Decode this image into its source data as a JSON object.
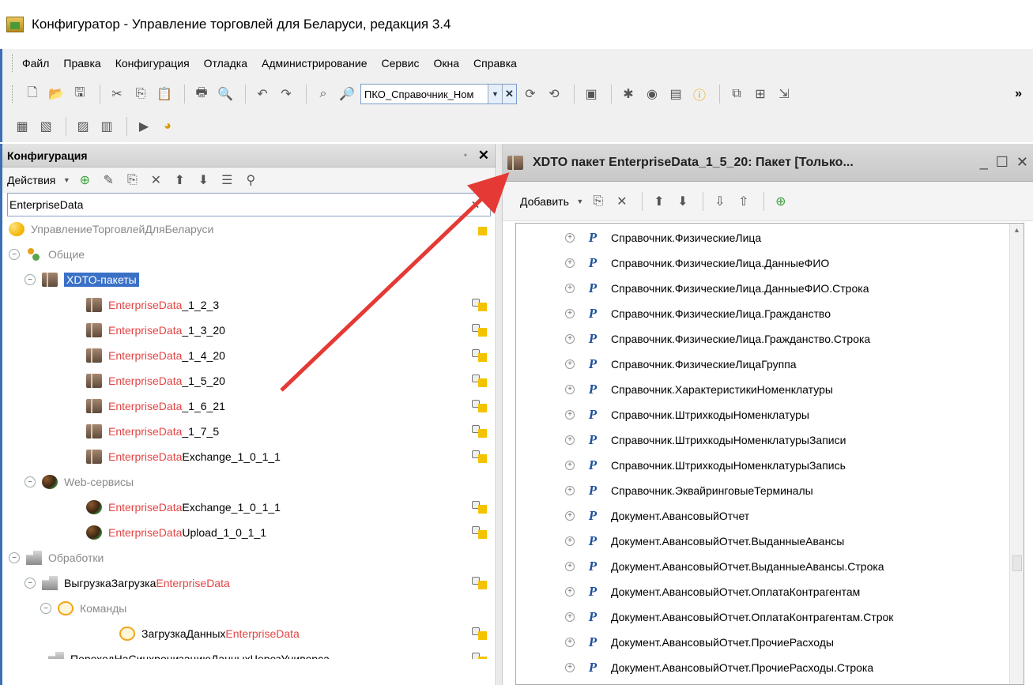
{
  "window": {
    "title": "Конфигуратор - Управление торговлей для Беларуси, редакция 3.4"
  },
  "menu": [
    "Файл",
    "Правка",
    "Конфигурация",
    "Отладка",
    "Администрирование",
    "Сервис",
    "Окна",
    "Справка"
  ],
  "toolbar": {
    "search_value": "ПКО_Справочник_Ном"
  },
  "left_panel": {
    "title": "Конфигурация",
    "actions_label": "Действия",
    "filter_value": "EnterpriseData",
    "tree": {
      "root": "УправлениеТорговлейДляБеларуси",
      "common": "Общие",
      "xdto_folder": "XDTO-пакеты",
      "xdto_items": [
        {
          "hl": "EnterpriseData",
          "rest": "_1_2_3"
        },
        {
          "hl": "EnterpriseData",
          "rest": "_1_3_20"
        },
        {
          "hl": "EnterpriseData",
          "rest": "_1_4_20"
        },
        {
          "hl": "EnterpriseData",
          "rest": "_1_5_20"
        },
        {
          "hl": "EnterpriseData",
          "rest": "_1_6_21"
        },
        {
          "hl": "EnterpriseData",
          "rest": "_1_7_5"
        },
        {
          "hl": "EnterpriseData",
          "rest": "Exchange_1_0_1_1"
        }
      ],
      "web_folder": "Web-сервисы",
      "web_items": [
        {
          "hl": "EnterpriseData",
          "rest": "Exchange_1_0_1_1"
        },
        {
          "hl": "EnterpriseData",
          "rest": "Upload_1_0_1_1"
        }
      ],
      "processing_folder": "Обработки",
      "processing_item": {
        "pre": "ВыгрузкаЗагрузка",
        "hl": "EnterpriseData"
      },
      "commands_folder": "Команды",
      "command_item": {
        "pre": "ЗагрузкаДанных",
        "hl": "EnterpriseData"
      },
      "last_item": "ПереходНаСинхронизациюДанныхЧерезУниверса..."
    }
  },
  "right_panel": {
    "title": "XDTO пакет EnterpriseData_1_5_20: Пакет [Только...",
    "add_label": "Добавить",
    "items": [
      "Справочник.ФизическиеЛица",
      "Справочник.ФизическиеЛица.ДанныеФИО",
      "Справочник.ФизическиеЛица.ДанныеФИО.Строка",
      "Справочник.ФизическиеЛица.Гражданство",
      "Справочник.ФизическиеЛица.Гражданство.Строка",
      "Справочник.ФизическиеЛицаГруппа",
      "Справочник.ХарактеристикиНоменклатуры",
      "Справочник.ШтрихкодыНоменклатуры",
      "Справочник.ШтрихкодыНоменклатурыЗаписи",
      "Справочник.ШтрихкодыНоменклатурыЗапись",
      "Справочник.ЭквайринговыеТерминалы",
      "Документ.АвансовыйОтчет",
      "Документ.АвансовыйОтчет.ВыданныеАвансы",
      "Документ.АвансовыйОтчет.ВыданныеАвансы.Строка",
      "Документ.АвансовыйОтчет.ОплатаКонтрагентам",
      "Документ.АвансовыйОтчет.ОплатаКонтрагентам.Строк",
      "Документ.АвансовыйОтчет.ПрочиеРасходы",
      "Документ.АвансовыйОтчет.ПрочиеРасходы.Строка"
    ]
  },
  "colors": {
    "accent": "#3a71c7",
    "highlight": "#e34444",
    "arrow": "#e53935"
  }
}
